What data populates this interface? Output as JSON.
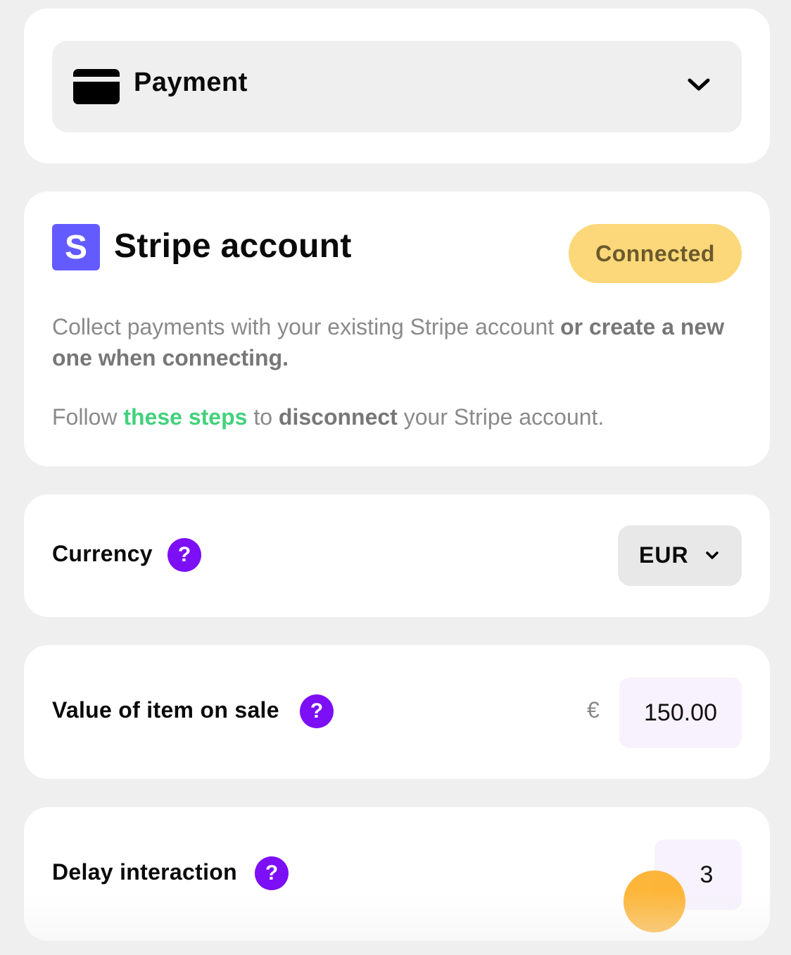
{
  "payment": {
    "label": "Payment",
    "icon": "credit-card-icon"
  },
  "stripe": {
    "logo_letter": "S",
    "title": "Stripe account",
    "status": "Connected",
    "desc_plain": "Collect payments with your existing Stripe account ",
    "desc_bold": "or create a new one when connecting.",
    "follow_prefix": "Follow ",
    "follow_link": "these steps",
    "follow_mid": " to ",
    "follow_bold": "disconnect",
    "follow_suffix": " your Stripe account."
  },
  "currency": {
    "label": "Currency",
    "help": "?",
    "value": "EUR"
  },
  "value_item": {
    "label": "Value of item on sale",
    "help": "?",
    "symbol": "€",
    "value": "150.00"
  },
  "delay": {
    "label": "Delay interaction",
    "help": "?",
    "value": "3"
  },
  "colors": {
    "accent_purple": "#7c0ff5",
    "stripe_blue": "#635bff",
    "badge_yellow": "#fcd87a",
    "link_green": "#43d17c",
    "cursor_orange": "#fdb028"
  }
}
